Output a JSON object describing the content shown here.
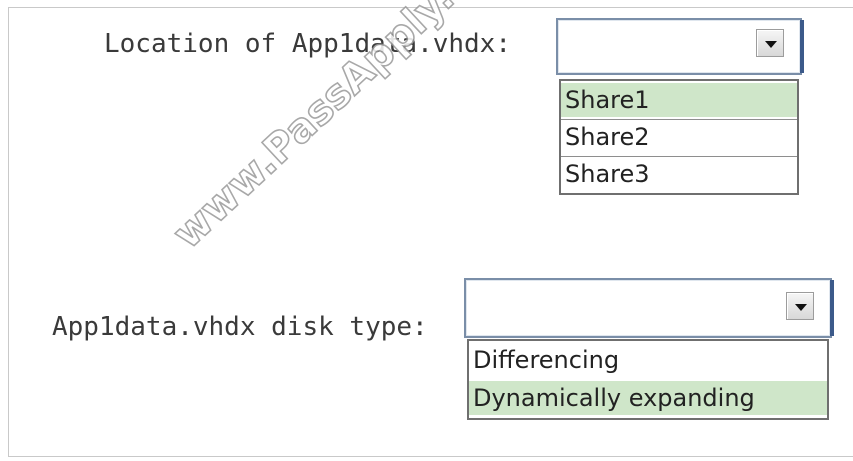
{
  "fields": [
    {
      "label": "Location of App1data.vhdx:",
      "value": "",
      "options": [
        {
          "label": "Share1",
          "selected": true
        },
        {
          "label": "Share2",
          "selected": false
        },
        {
          "label": "Share3",
          "selected": false
        }
      ]
    },
    {
      "label": "App1data.vhdx disk type:",
      "value": "",
      "options": [
        {
          "label": "Differencing",
          "selected": false
        },
        {
          "label": "Dynamically expanding",
          "selected": true
        }
      ]
    }
  ],
  "watermark": "www.PassApply.com",
  "colors": {
    "selected_option_bg": "#cfe6c9",
    "combo_border": "#7a8ea8",
    "combo_focus": "#3c5a8a"
  },
  "icons": {
    "dropdown": "chevron-down-icon"
  }
}
